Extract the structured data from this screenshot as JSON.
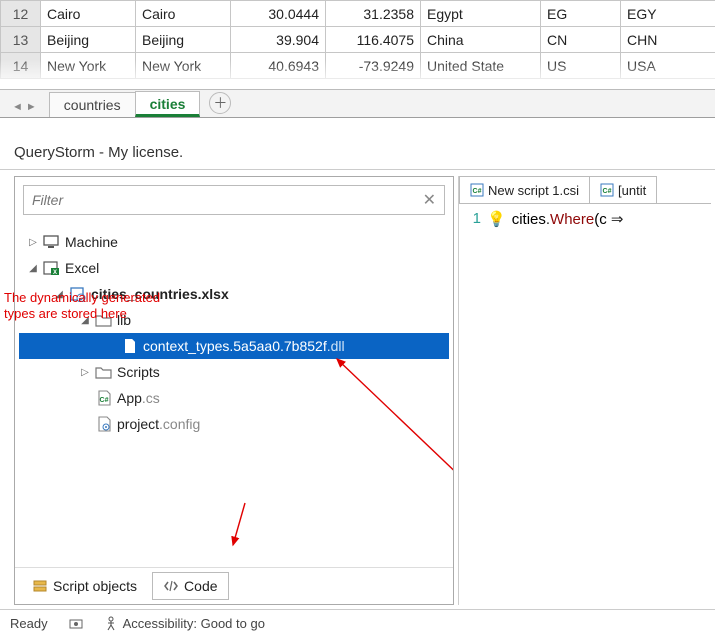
{
  "sheet": {
    "rows": [
      {
        "n": "12",
        "c": [
          "Cairo",
          "Cairo",
          "30.0444",
          "31.2358",
          "Egypt",
          "EG",
          "EGY"
        ]
      },
      {
        "n": "13",
        "c": [
          "Beijing",
          "Beijing",
          "39.904",
          "116.4075",
          "China",
          "CN",
          "CHN"
        ]
      },
      {
        "n": "14",
        "c": [
          "New York",
          "New York",
          "40.6943",
          "-73.9249",
          "United State",
          "US",
          "USA"
        ]
      }
    ]
  },
  "ws_tabs": {
    "inactive": "countries",
    "active": "cities"
  },
  "panel_title": "QueryStorm - My license.",
  "filter": {
    "placeholder": "Filter"
  },
  "tree": {
    "machine": "Machine",
    "excel": "Excel",
    "workbook": "cities_countries.xlsx",
    "lib": "lib",
    "dll_name": "context_types.5a5aa0.7b852f",
    "dll_ext": ".dll",
    "scripts": "Scripts",
    "app_name": "App",
    "app_ext": ".cs",
    "proj_name": "project",
    "proj_ext": ".config"
  },
  "bottom_tabs": {
    "objects": "Script objects",
    "code": "Code"
  },
  "editor": {
    "tabs": [
      "New script 1.csi",
      "[untit"
    ],
    "line_no": "1",
    "code_ident": "cities",
    "code_dot": ".",
    "code_method": "Where",
    "code_open": "(",
    "code_var": "c",
    "code_arrow": " ⇒"
  },
  "annotations": {
    "text": "The dynamically generated\ntypes are stored here"
  },
  "status": {
    "ready": "Ready",
    "acc": "Accessibility: Good to go"
  }
}
